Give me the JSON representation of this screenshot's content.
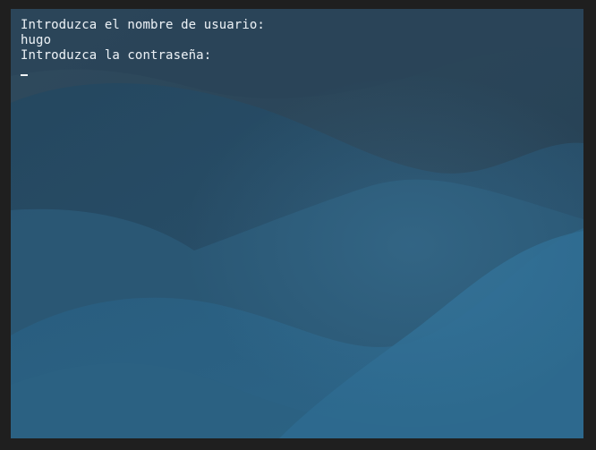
{
  "terminal": {
    "lines": [
      "Introduzca el nombre de usuario:",
      "hugo",
      "Introduzca la contraseña:"
    ]
  },
  "colors": {
    "background": "#24445a",
    "text": "#e8eef3",
    "frame": "#1f1f1f"
  }
}
